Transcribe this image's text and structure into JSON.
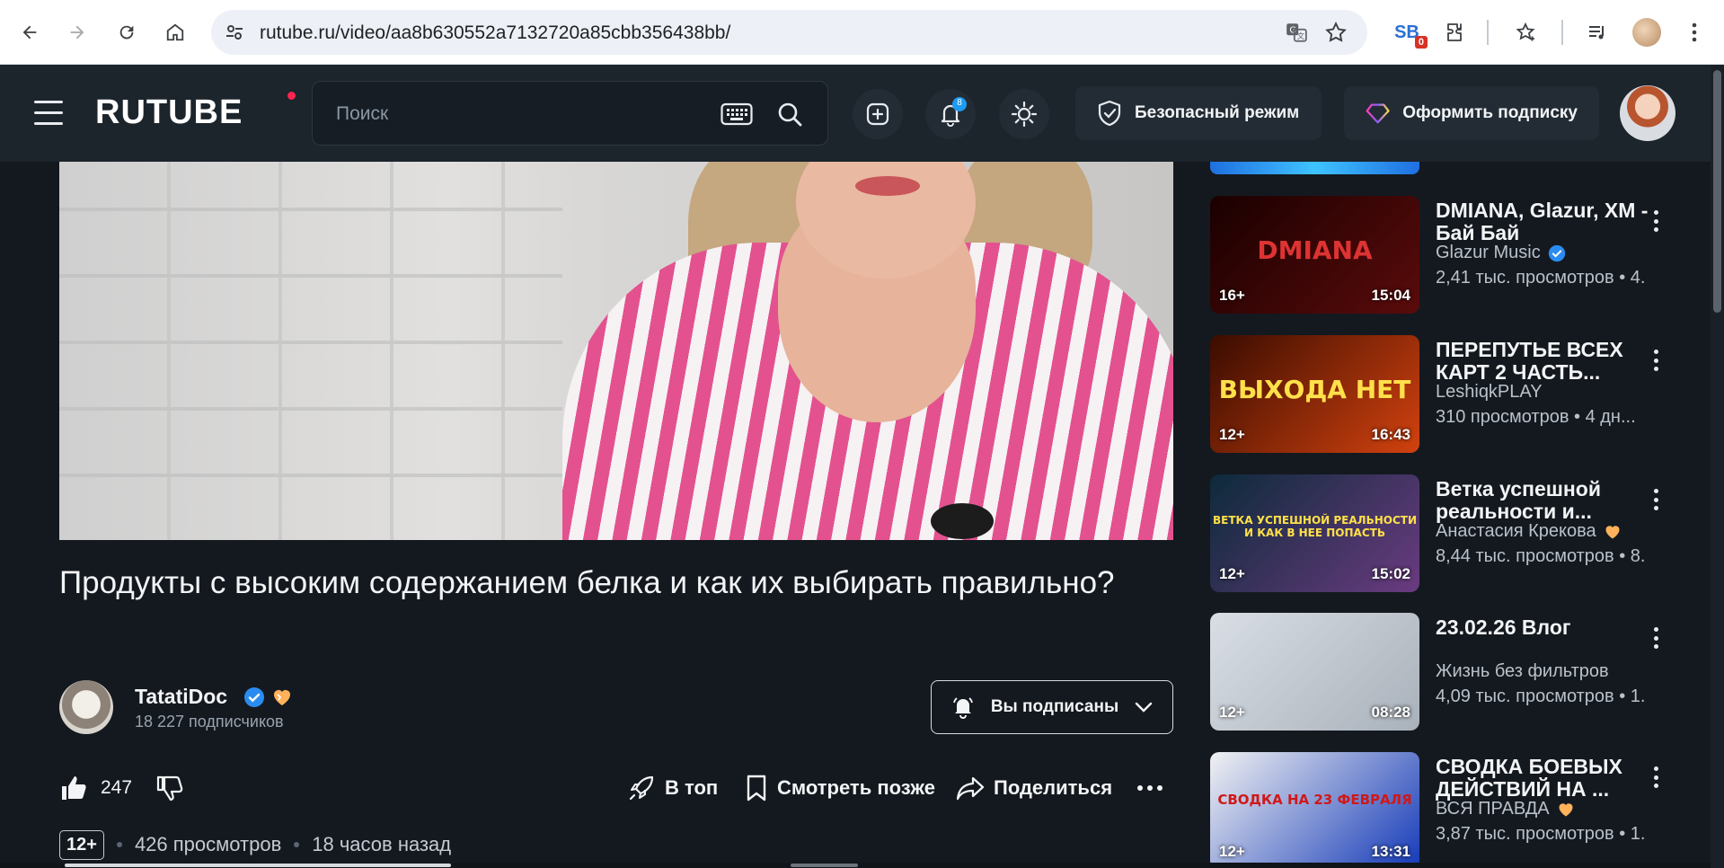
{
  "browser": {
    "url": "rutube.ru/video/aa8b630552a7132720a85cbb356438bb/",
    "extension_badge": "0",
    "icons": [
      "back-icon",
      "forward-icon",
      "reload-icon",
      "home-icon",
      "site-settings-icon",
      "translate-icon",
      "bookmark-star-icon",
      "extensions-icon",
      "reading-list-icon",
      "media-icon",
      "menu-kebab-icon"
    ]
  },
  "header": {
    "logo": "RUTUBE",
    "search_placeholder": "Поиск",
    "notifications_count": "8",
    "safe_mode_label": "Безопасный режим",
    "subscribe_label": "Оформить подписку",
    "accent": "#ff2450"
  },
  "video": {
    "title": "Продукты с высоким содержанием белка и как их выбирать правильно?",
    "channel": {
      "name": "TatatiDoc",
      "subscribers": "18 227 подписчиков",
      "verified": true
    },
    "subscribed_label": "Вы подписаны",
    "likes": "247",
    "actions": {
      "top": "В топ",
      "watch_later": "Смотреть позже",
      "share": "Поделиться"
    },
    "age": "12+",
    "views": "426 просмотров",
    "published": "18 часов назад"
  },
  "recommendations": [
    {
      "title": "DMIANA, Glazur, XM - Бай Бай",
      "channel": "Glazur Music",
      "verified": true,
      "heart": false,
      "views": "2,41 тыс. просмотров  •  4.",
      "age": "16+",
      "duration": "15:04",
      "thumb_text": "DMIANA",
      "thumb_colors": [
        "#1a0000",
        "#5a0b0b"
      ]
    },
    {
      "title": "ПЕРЕПУТЬЕ ВСЕХ КАРТ 2 ЧАСТЬ...",
      "channel": "LeshiqkPLAY",
      "verified": false,
      "heart": false,
      "views": "310 просмотров  •  4 дн...",
      "age": "12+",
      "duration": "16:43",
      "thumb_text": "ВЫХОДА НЕТ",
      "thumb_colors": [
        "#3a0c00",
        "#d2420f"
      ]
    },
    {
      "title": "Ветка успешной реальности и...",
      "channel": "Анастасия Крекова",
      "verified": false,
      "heart": true,
      "views": "8,44 тыс. просмотров  •  8.",
      "age": "12+",
      "duration": "15:02",
      "thumb_text": "ВЕТКА УСПЕШНОЙ РЕАЛЬНОСТИ И КАК В НЕЕ ПОПАСТЬ",
      "thumb_colors": [
        "#0d2a3a",
        "#6a3b80"
      ]
    },
    {
      "title": "23.02.26 Влог",
      "channel": "Жизнь без фильтров",
      "verified": false,
      "heart": false,
      "views": "4,09 тыс. просмотров  •  1.",
      "age": "12+",
      "duration": "08:28",
      "thumb_text": "",
      "thumb_colors": [
        "#d9dee5",
        "#a9b1ba"
      ]
    },
    {
      "title": "СВОДКА БОЕВЫХ ДЕЙСТВИЙ НА ...",
      "channel": "ВСЯ ПРАВДА",
      "verified": false,
      "heart": true,
      "views": "3,87 тыс. просмотров  •  1.",
      "age": "12+",
      "duration": "13:31",
      "thumb_text": "СВОДКА НА 23 ФЕВРАЛЯ",
      "thumb_colors": [
        "#f2f2f2",
        "#1339b8"
      ]
    }
  ]
}
